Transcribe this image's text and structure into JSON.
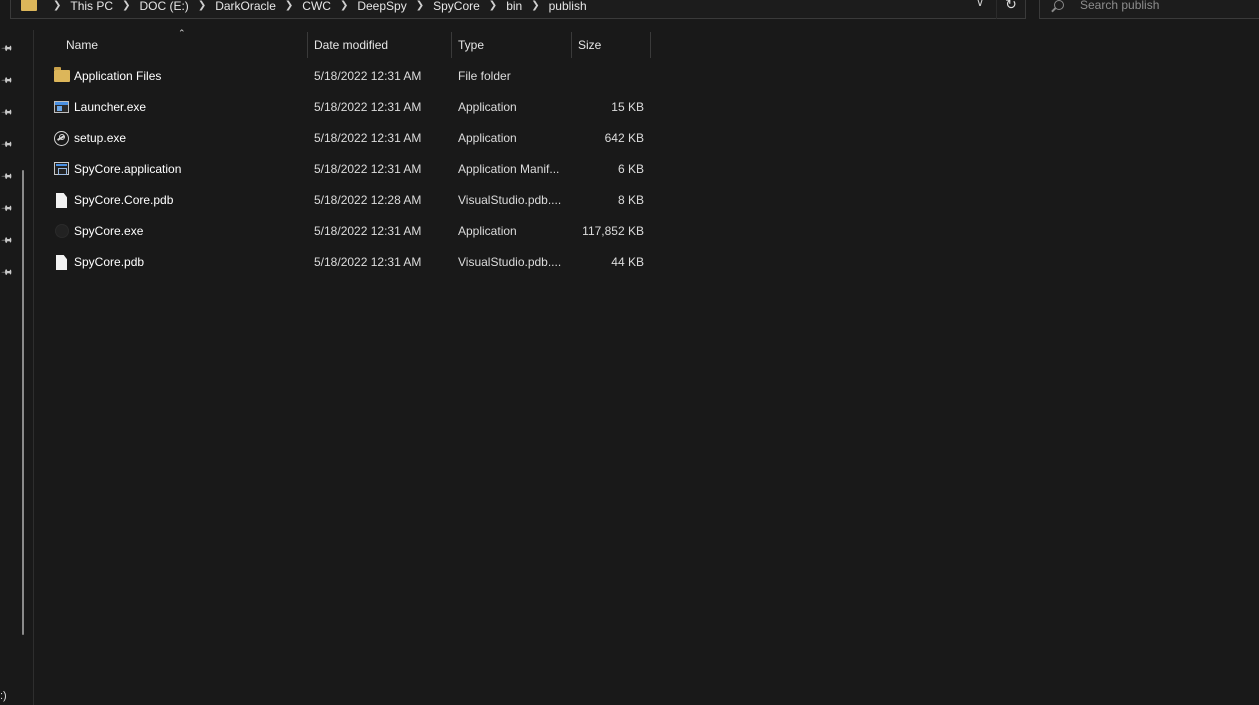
{
  "address_bar": {
    "crumbs": [
      "This PC",
      "DOC (E:)",
      "DarkOracle",
      "CWC",
      "DeepSpy",
      "SpyCore",
      "bin",
      "publish"
    ],
    "dropdown_icon": "chevron-down-icon",
    "refresh_icon": "refresh-icon"
  },
  "search": {
    "placeholder": "Search publish"
  },
  "nav": {
    "drive_fragment": ":)",
    "pin_count": 8
  },
  "columns": {
    "name": "Name",
    "date": "Date modified",
    "type": "Type",
    "size": "Size",
    "sorted_by": "Name",
    "sort_direction": "ascending"
  },
  "files": [
    {
      "name": "Application Files",
      "date": "5/18/2022 12:31 AM",
      "type": "File folder",
      "size": "",
      "icon": "folder-icon"
    },
    {
      "name": "Launcher.exe",
      "date": "5/18/2022 12:31 AM",
      "type": "Application",
      "size": "15 KB",
      "icon": "exe-icon"
    },
    {
      "name": "setup.exe",
      "date": "5/18/2022 12:31 AM",
      "type": "Application",
      "size": "642 KB",
      "icon": "setup-icon"
    },
    {
      "name": "SpyCore.application",
      "date": "5/18/2022 12:31 AM",
      "type": "Application Manif...",
      "size": "6 KB",
      "icon": "manifest-icon"
    },
    {
      "name": "SpyCore.Core.pdb",
      "date": "5/18/2022 12:28 AM",
      "type": "VisualStudio.pdb....",
      "size": "8 KB",
      "icon": "document-icon"
    },
    {
      "name": "SpyCore.exe",
      "date": "5/18/2022 12:31 AM",
      "type": "Application",
      "size": "117,852 KB",
      "icon": "app-icon"
    },
    {
      "name": "SpyCore.pdb",
      "date": "5/18/2022 12:31 AM",
      "type": "VisualStudio.pdb....",
      "size": "44 KB",
      "icon": "document-icon"
    }
  ]
}
